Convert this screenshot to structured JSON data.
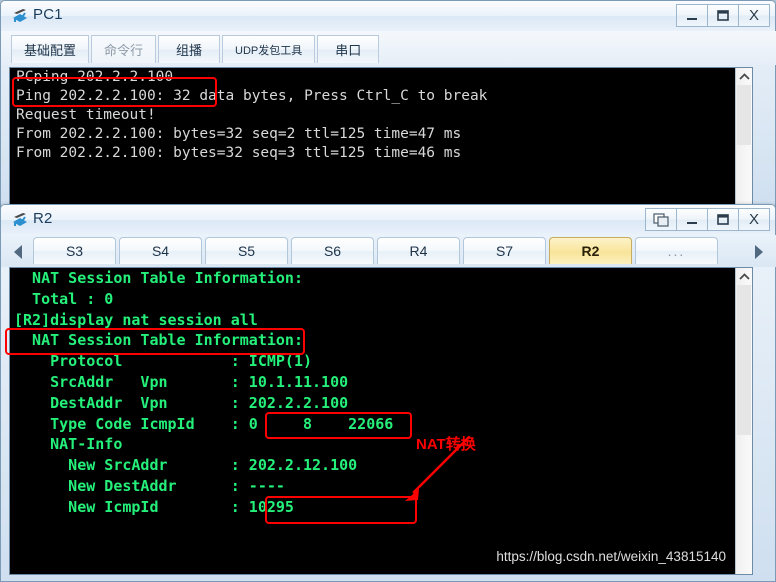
{
  "pc1_window": {
    "title": "PC1",
    "icon": "router-device-icon",
    "controls": [
      {
        "name": "minimize",
        "glyph": "minimize-icon"
      },
      {
        "name": "maximize",
        "glyph": "maximize-icon"
      },
      {
        "name": "close",
        "glyph": "X"
      }
    ],
    "tabs": [
      {
        "label": "基础配置",
        "active": true
      },
      {
        "label": "命令行",
        "active": false,
        "dim": true
      },
      {
        "label": "组播",
        "active": false
      },
      {
        "label": "UDP发包工具",
        "active": false,
        "small": true
      },
      {
        "label": "串口",
        "active": false
      }
    ],
    "terminal": {
      "lines": [
        "PCping 202.2.2.100",
        "",
        "Ping 202.2.2.100: 32 data bytes, Press Ctrl_C to break",
        "Request timeout!",
        "From 202.2.2.100: bytes=32 seq=2 ttl=125 time=47 ms",
        "From 202.2.2.100: bytes=32 seq=3 ttl=125 time=46 ms"
      ]
    }
  },
  "r2_window": {
    "title": "R2",
    "icon": "router-device-icon",
    "controls": [
      {
        "name": "restore-cascade",
        "glyph": "cascade-icon"
      },
      {
        "name": "minimize",
        "glyph": "minimize-icon"
      },
      {
        "name": "maximize",
        "glyph": "maximize-icon"
      },
      {
        "name": "close",
        "glyph": "X"
      }
    ],
    "tabs": [
      {
        "label": "S3",
        "active": false
      },
      {
        "label": "S4",
        "active": false
      },
      {
        "label": "S5",
        "active": false
      },
      {
        "label": "S6",
        "active": false
      },
      {
        "label": "R4",
        "active": false
      },
      {
        "label": "S7",
        "active": false
      },
      {
        "label": "R2",
        "active": true
      },
      {
        "label": "...",
        "active": false,
        "more": true
      }
    ],
    "nav": {
      "prev_icon": "triangle-left-icon",
      "next_icon": "triangle-right-icon"
    },
    "terminal": {
      "lines": [
        "  NAT Session Table Information:",
        "",
        "  Total : 0",
        "[R2]display nat session all",
        "  NAT Session Table Information:",
        "",
        "    Protocol            : ICMP(1)",
        "    SrcAddr   Vpn       : 10.1.11.100",
        "    DestAddr  Vpn       : 202.2.2.100",
        "    Type Code IcmpId    : 0     8    22066",
        "    NAT-Info",
        "      New SrcAddr       : 202.2.12.100",
        "      New DestAddr      : ----",
        "      New IcmpId        : 10295"
      ]
    }
  },
  "annotations": {
    "nat_label": "NAT转换",
    "highlight_color": "#ff0000",
    "boxes": [
      {
        "name": "pcping-command-highlight",
        "target": "PCping 202.2.2.100"
      },
      {
        "name": "display-nat-session-highlight",
        "target": "[R2]display nat session all"
      },
      {
        "name": "src-addr-highlight",
        "target": "10.1.11.100"
      },
      {
        "name": "new-src-addr-highlight",
        "target": "202.2.12.100"
      }
    ]
  },
  "watermark": {
    "text": "https://blog.csdn.net/weixin_43815140"
  }
}
